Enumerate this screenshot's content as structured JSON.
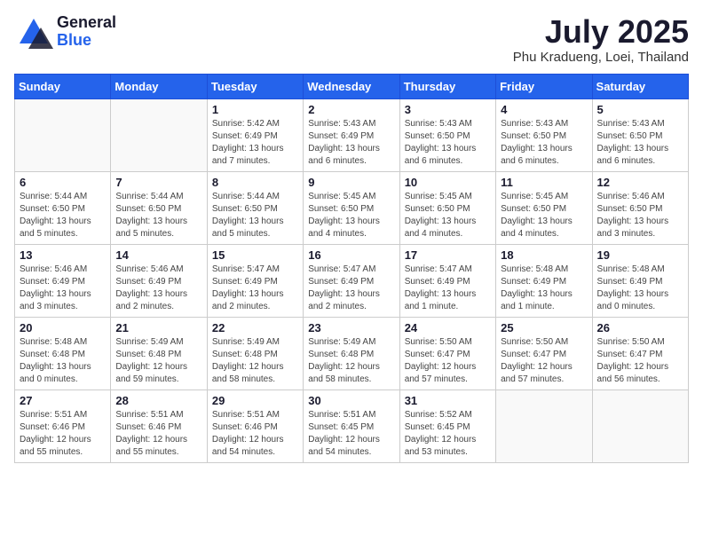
{
  "header": {
    "logo_general": "General",
    "logo_blue": "Blue",
    "month_title": "July 2025",
    "location": "Phu Kradueng, Loei, Thailand"
  },
  "days_of_week": [
    "Sunday",
    "Monday",
    "Tuesday",
    "Wednesday",
    "Thursday",
    "Friday",
    "Saturday"
  ],
  "weeks": [
    [
      {
        "day": "",
        "details": ""
      },
      {
        "day": "",
        "details": ""
      },
      {
        "day": "1",
        "details": "Sunrise: 5:42 AM\nSunset: 6:49 PM\nDaylight: 13 hours\nand 7 minutes."
      },
      {
        "day": "2",
        "details": "Sunrise: 5:43 AM\nSunset: 6:49 PM\nDaylight: 13 hours\nand 6 minutes."
      },
      {
        "day": "3",
        "details": "Sunrise: 5:43 AM\nSunset: 6:50 PM\nDaylight: 13 hours\nand 6 minutes."
      },
      {
        "day": "4",
        "details": "Sunrise: 5:43 AM\nSunset: 6:50 PM\nDaylight: 13 hours\nand 6 minutes."
      },
      {
        "day": "5",
        "details": "Sunrise: 5:43 AM\nSunset: 6:50 PM\nDaylight: 13 hours\nand 6 minutes."
      }
    ],
    [
      {
        "day": "6",
        "details": "Sunrise: 5:44 AM\nSunset: 6:50 PM\nDaylight: 13 hours\nand 5 minutes."
      },
      {
        "day": "7",
        "details": "Sunrise: 5:44 AM\nSunset: 6:50 PM\nDaylight: 13 hours\nand 5 minutes."
      },
      {
        "day": "8",
        "details": "Sunrise: 5:44 AM\nSunset: 6:50 PM\nDaylight: 13 hours\nand 5 minutes."
      },
      {
        "day": "9",
        "details": "Sunrise: 5:45 AM\nSunset: 6:50 PM\nDaylight: 13 hours\nand 4 minutes."
      },
      {
        "day": "10",
        "details": "Sunrise: 5:45 AM\nSunset: 6:50 PM\nDaylight: 13 hours\nand 4 minutes."
      },
      {
        "day": "11",
        "details": "Sunrise: 5:45 AM\nSunset: 6:50 PM\nDaylight: 13 hours\nand 4 minutes."
      },
      {
        "day": "12",
        "details": "Sunrise: 5:46 AM\nSunset: 6:50 PM\nDaylight: 13 hours\nand 3 minutes."
      }
    ],
    [
      {
        "day": "13",
        "details": "Sunrise: 5:46 AM\nSunset: 6:49 PM\nDaylight: 13 hours\nand 3 minutes."
      },
      {
        "day": "14",
        "details": "Sunrise: 5:46 AM\nSunset: 6:49 PM\nDaylight: 13 hours\nand 2 minutes."
      },
      {
        "day": "15",
        "details": "Sunrise: 5:47 AM\nSunset: 6:49 PM\nDaylight: 13 hours\nand 2 minutes."
      },
      {
        "day": "16",
        "details": "Sunrise: 5:47 AM\nSunset: 6:49 PM\nDaylight: 13 hours\nand 2 minutes."
      },
      {
        "day": "17",
        "details": "Sunrise: 5:47 AM\nSunset: 6:49 PM\nDaylight: 13 hours\nand 1 minute."
      },
      {
        "day": "18",
        "details": "Sunrise: 5:48 AM\nSunset: 6:49 PM\nDaylight: 13 hours\nand 1 minute."
      },
      {
        "day": "19",
        "details": "Sunrise: 5:48 AM\nSunset: 6:49 PM\nDaylight: 13 hours\nand 0 minutes."
      }
    ],
    [
      {
        "day": "20",
        "details": "Sunrise: 5:48 AM\nSunset: 6:48 PM\nDaylight: 13 hours\nand 0 minutes."
      },
      {
        "day": "21",
        "details": "Sunrise: 5:49 AM\nSunset: 6:48 PM\nDaylight: 12 hours\nand 59 minutes."
      },
      {
        "day": "22",
        "details": "Sunrise: 5:49 AM\nSunset: 6:48 PM\nDaylight: 12 hours\nand 58 minutes."
      },
      {
        "day": "23",
        "details": "Sunrise: 5:49 AM\nSunset: 6:48 PM\nDaylight: 12 hours\nand 58 minutes."
      },
      {
        "day": "24",
        "details": "Sunrise: 5:50 AM\nSunset: 6:47 PM\nDaylight: 12 hours\nand 57 minutes."
      },
      {
        "day": "25",
        "details": "Sunrise: 5:50 AM\nSunset: 6:47 PM\nDaylight: 12 hours\nand 57 minutes."
      },
      {
        "day": "26",
        "details": "Sunrise: 5:50 AM\nSunset: 6:47 PM\nDaylight: 12 hours\nand 56 minutes."
      }
    ],
    [
      {
        "day": "27",
        "details": "Sunrise: 5:51 AM\nSunset: 6:46 PM\nDaylight: 12 hours\nand 55 minutes."
      },
      {
        "day": "28",
        "details": "Sunrise: 5:51 AM\nSunset: 6:46 PM\nDaylight: 12 hours\nand 55 minutes."
      },
      {
        "day": "29",
        "details": "Sunrise: 5:51 AM\nSunset: 6:46 PM\nDaylight: 12 hours\nand 54 minutes."
      },
      {
        "day": "30",
        "details": "Sunrise: 5:51 AM\nSunset: 6:45 PM\nDaylight: 12 hours\nand 54 minutes."
      },
      {
        "day": "31",
        "details": "Sunrise: 5:52 AM\nSunset: 6:45 PM\nDaylight: 12 hours\nand 53 minutes."
      },
      {
        "day": "",
        "details": ""
      },
      {
        "day": "",
        "details": ""
      }
    ]
  ]
}
